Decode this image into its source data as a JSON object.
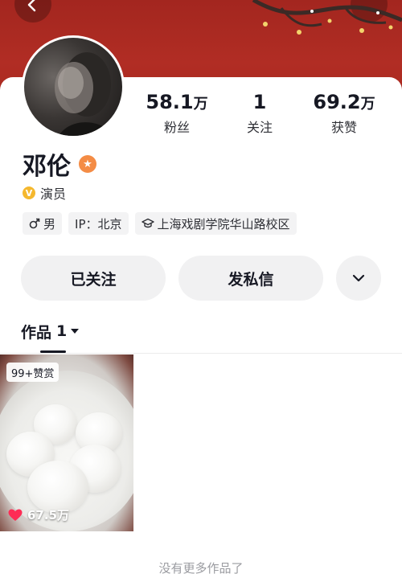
{
  "colors": {
    "banner": "#a8291f",
    "verified_badge": "#f5b82e",
    "name_badge": "#f48c45",
    "heart": "#fe2c55"
  },
  "profile": {
    "name": "邓伦",
    "title": "演员",
    "verified_mark": "V"
  },
  "stats": {
    "fans": {
      "value": "58.1",
      "unit": "万",
      "label": "粉丝"
    },
    "following": {
      "value": "1",
      "unit": "",
      "label": "关注"
    },
    "likes": {
      "value": "69.2",
      "unit": "万",
      "label": "获赞"
    }
  },
  "tags": {
    "gender": "男",
    "ip": "IP：北京",
    "school": "上海戏剧学院华山路校区"
  },
  "actions": {
    "follow_label": "已关注",
    "message_label": "发私信",
    "more_icon": "chevron-down-icon"
  },
  "tabs": {
    "works_label": "作品",
    "works_count": "1"
  },
  "works": [
    {
      "reward_badge": "99+赞赏",
      "likes": "67.5万"
    }
  ],
  "footer": {
    "no_more_text": "没有更多作品了"
  }
}
